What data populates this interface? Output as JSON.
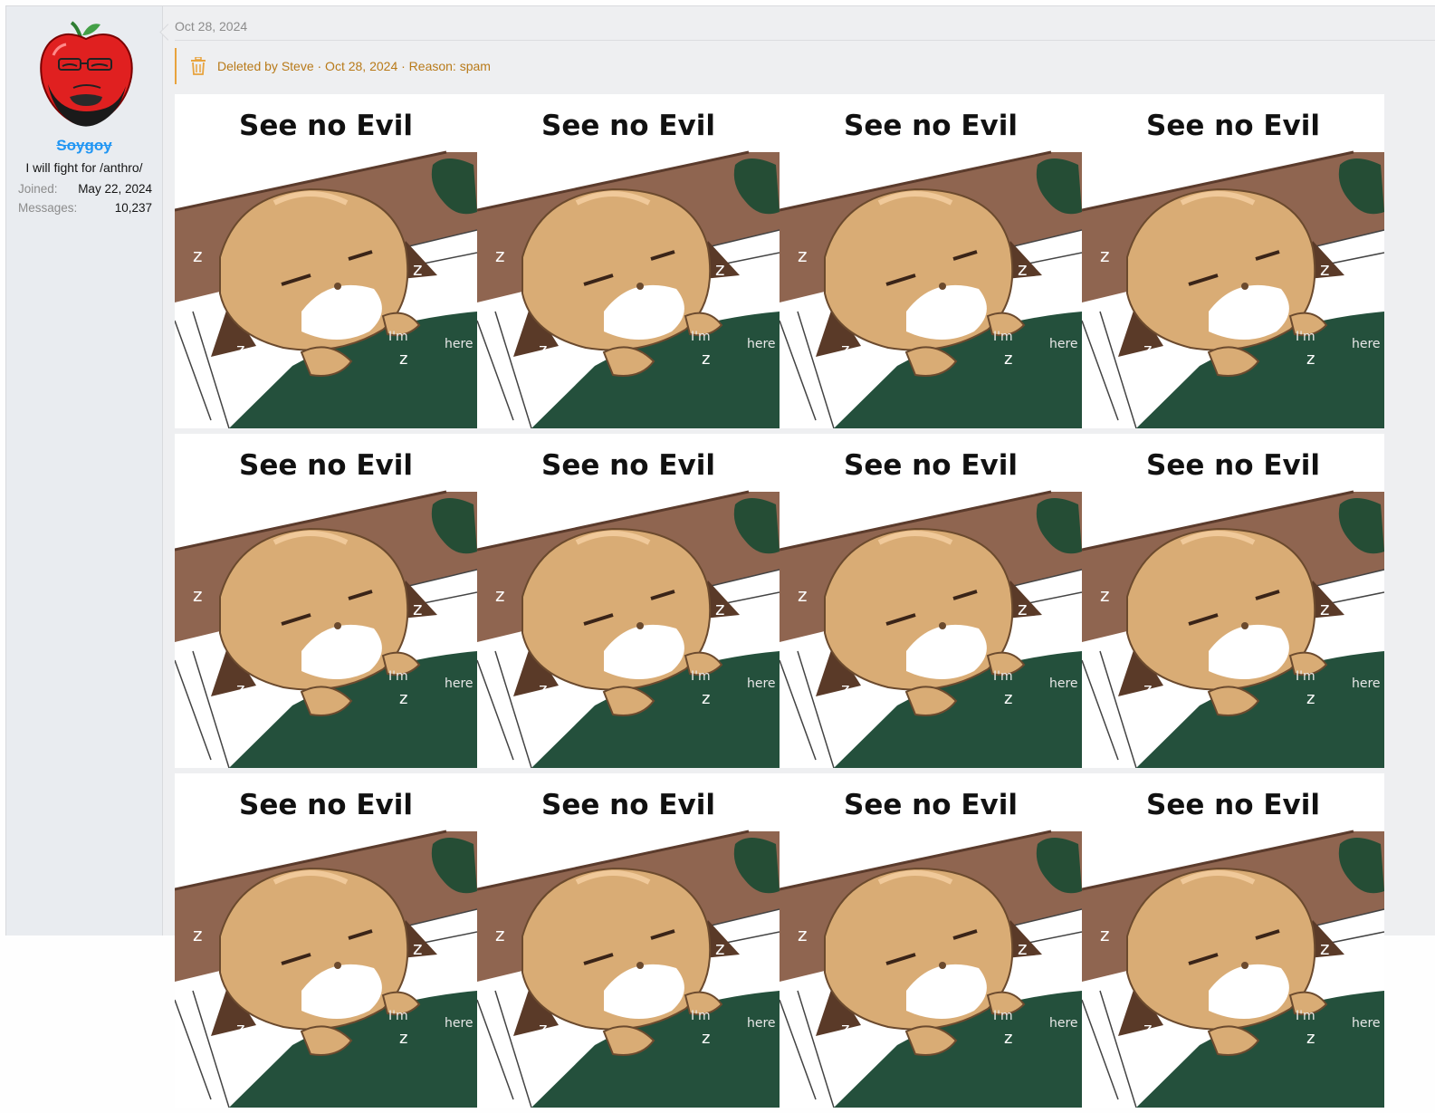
{
  "post": {
    "date": "Oct 28, 2024",
    "deleted_notice": "Deleted by Steve · Oct 28, 2024 · Reason: spam"
  },
  "user": {
    "username": "Soygoy",
    "title": "I will fight for /anthro/",
    "stats": [
      {
        "label": "Joined:",
        "value": "May 22, 2024"
      },
      {
        "label": "Messages:",
        "value": "10,237"
      }
    ]
  },
  "image": {
    "caption": "See no Evil",
    "rows": 3,
    "cols": 4,
    "scribbles": [
      "I'm",
      "here"
    ]
  },
  "colors": {
    "username": "#2196f3",
    "deleted_accent": "#e8a33d",
    "deleted_text": "#b87a19"
  },
  "icons": [
    "apple-avatar-icon",
    "trash-icon"
  ]
}
